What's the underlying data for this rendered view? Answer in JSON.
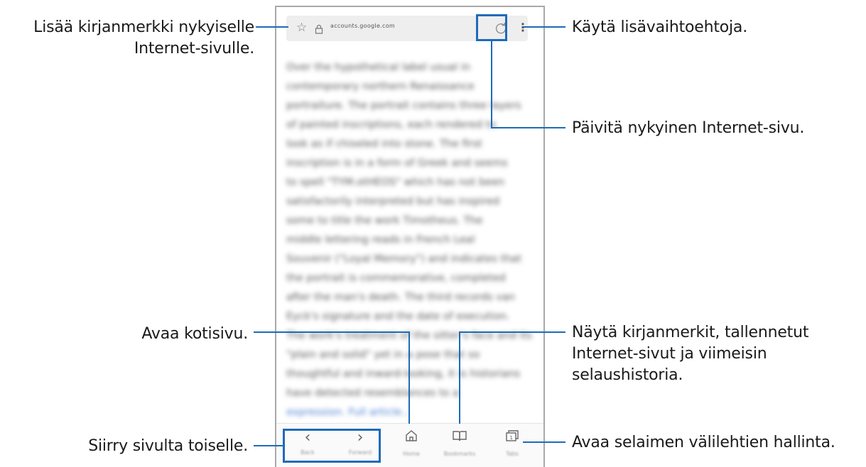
{
  "callouts": {
    "bookmark_line1": "Lisää kirjanmerkki nykyiselle",
    "bookmark_line2": "Internet-sivulle.",
    "more_options": "Käytä lisävaihtoehtoja.",
    "refresh": "Päivitä nykyinen Internet-sivu.",
    "home": "Avaa kotisivu.",
    "bookmarks_line1": "Näytä kirjanmerkit, tallennetut",
    "bookmarks_line2": "Internet-sivut ja viimeisin",
    "bookmarks_line3": "selaushistoria.",
    "navigate": "Siirry sivulta toiselle.",
    "tabs": "Avaa selaimen välilehtien hallinta."
  },
  "browser": {
    "url": "accounts.google.com",
    "icons": {
      "star": "☆",
      "lock": "🔒",
      "refresh": "↻",
      "more": "⋮",
      "back": "‹",
      "forward": "›",
      "home": "⌂",
      "bookmarks": "🕮",
      "tabs": "❐"
    },
    "content_lines": [
      "Over the hypothetical label usual in",
      "contemporary northern Renaissance",
      "portraiture. The portrait contains three layers",
      "of painted inscriptions, each rendered to",
      "look as if chiseled into stone. The first",
      "inscription is in a form of Greek and seems",
      "to spell \"TYM.otHEOS\" which has not been",
      "satisfactorily interpreted but has inspired",
      "some to title the work Timotheus. The",
      "middle lettering reads in French Leal",
      "Souvenir (\"Loyal Memory\") and indicates that",
      "the portrait is commemorative, completed",
      "after the man's death. The third records van",
      "Eyck's signature and the date of execution.",
      "The work's treatment of the sitter's face and its",
      "\"plain and solid\" yet in a pose that so",
      "thoughtful and inward-looking, it is historians",
      "have detected resemblances to a",
      "expression. Full article..."
    ],
    "bottom_labels": {
      "back": "Back",
      "forward": "Forward",
      "home": "Home",
      "bookmarks": "Bookmarks",
      "tabs": "Tabs"
    }
  },
  "colors": {
    "accent": "#1e6bb8",
    "frame": "#a9a9a9",
    "urlbar": "#eeeeee"
  }
}
